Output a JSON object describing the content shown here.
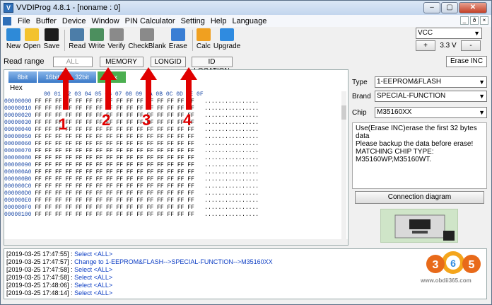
{
  "window": {
    "title": "VVDIProg 4.8.1 - [noname : 0]",
    "minimize": "–",
    "maximize": "▢",
    "close": "✕"
  },
  "menu": [
    "File",
    "Buffer",
    "Device",
    "Window",
    "PIN Calculator",
    "Setting",
    "Help",
    "Language"
  ],
  "mdi": [
    "_",
    "ð",
    "×"
  ],
  "toolbar": [
    {
      "label": "New",
      "icon": "new-icon",
      "color": "#2e8ad8"
    },
    {
      "label": "Open",
      "icon": "open-folder-icon",
      "color": "#f3c22e"
    },
    {
      "label": "Save",
      "icon": "save-disk-icon",
      "color": "#1c1c1c"
    },
    {
      "label": "Read",
      "icon": "read-chip-icon",
      "color": "#4c7da8"
    },
    {
      "label": "Write",
      "icon": "write-chip-icon",
      "color": "#4c8f5e"
    },
    {
      "label": "Verify",
      "icon": "verify-icon",
      "color": "#8a8a8a"
    },
    {
      "label": "CheckBlank",
      "icon": "checkblank-icon",
      "color": "#8a8a8a"
    },
    {
      "label": "Erase",
      "icon": "erase-icon",
      "color": "#3a7ed4"
    },
    {
      "label": "Calc",
      "icon": "calculator-icon",
      "color": "#f0a020"
    },
    {
      "label": "Upgrade",
      "icon": "upgrade-arrow-icon",
      "color": "#2f8be0"
    }
  ],
  "vcc": {
    "selected": "VCC",
    "plus": "+",
    "value": "3.3 V",
    "minus": "-"
  },
  "read_range": {
    "label": "Read range",
    "buttons": [
      "ALL",
      "MEMORY",
      "LONGID",
      "ID LOCATION"
    ],
    "erase_inc": "Erase INC"
  },
  "bit_tabs": [
    "8bit",
    "16bit",
    "32bit",
    "Hex"
  ],
  "hex_label": "Hex",
  "hex_header": "00 01 02 03 04 05 06 07 08 09 0A 0B 0C 0D 0E 0F",
  "hex_rows": [
    "00000000",
    "00000010",
    "00000020",
    "00000030",
    "00000040",
    "00000050",
    "00000060",
    "00000070",
    "00000080",
    "00000090",
    "000000A0",
    "000000B0",
    "000000C0",
    "000000D0",
    "000000E0",
    "000000F0",
    "00000100"
  ],
  "hex_bytes": "FF FF FF FF FF FF FF FF FF FF FF FF FF FF FF FF",
  "hex_ascii": "................",
  "right": {
    "type_label": "Type",
    "type_value": "1-EEPROM&FLASH",
    "brand_label": "Brand",
    "brand_value": "SPECIAL-FUNCTION",
    "chip_label": "Chip",
    "chip_value": "M35160XX",
    "info": [
      "Use(Erase INC)erase the first 32 bytes data",
      "Please backup the data before erase!",
      "MATCHING CHIP TYPE:",
      "M35160WP,M35160WT."
    ],
    "connection_button": "Connection diagram"
  },
  "log": [
    {
      "ts": "[2019-03-25 17:47:55] :",
      "msg": "Select <ALL>"
    },
    {
      "ts": "[2019-03-25 17:47:57] :",
      "msg": "Change to 1-EEPROM&FLASH-->SPECIAL-FUNCTION-->M35160XX"
    },
    {
      "ts": "[2019-03-25 17:47:58] :",
      "msg": "Select <ALL>"
    },
    {
      "ts": "[2019-03-25 17:47:58] :",
      "msg": "Select <ALL>"
    },
    {
      "ts": "[2019-03-25 17:48:06] :",
      "msg": "Select <ALL>"
    },
    {
      "ts": "[2019-03-25 17:48:14] :",
      "msg": "Select <ALL>"
    }
  ],
  "annotations": [
    "1",
    "2",
    "3",
    "4"
  ],
  "watermark": {
    "brand": "365",
    "url": "www.obdii365.com"
  }
}
